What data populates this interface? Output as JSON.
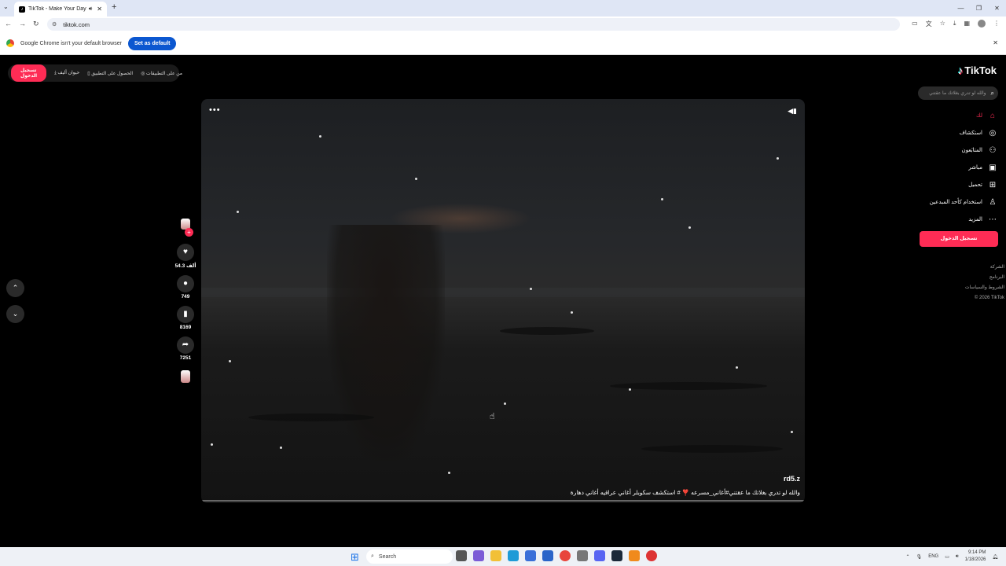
{
  "browser": {
    "tab_title": "TikTok - Make Your Day",
    "url": "tiktok.com",
    "infobar_text": "Google Chrome isn't your default browser",
    "set_default_label": "Set as default"
  },
  "top_pill": {
    "login_label": "تسجيل الدخول",
    "items": [
      "حيوان أليف",
      "الحصول على التطبيق",
      "من على التطبيقات"
    ]
  },
  "video": {
    "author": "rd5.z",
    "caption": "والله لو تدري بغلاتك ما عقتني#أغاني_مسرعه ❣️ # استكشف سكوبلر أغاني عراقيه أغاني دهارة"
  },
  "actions": {
    "likes": "54.3 ألف",
    "comments": "749",
    "bookmarks": "8169",
    "shares": "7251"
  },
  "sidebar": {
    "logo": "TikTok",
    "search_placeholder": "والله لو تدري بغلاتك ما عقتني",
    "items": [
      {
        "label": "لك",
        "icon": "home-icon"
      },
      {
        "label": "استكشاف",
        "icon": "compass-icon"
      },
      {
        "label": "المتابَعون",
        "icon": "following-icon"
      },
      {
        "label": "مباشر",
        "icon": "live-icon"
      },
      {
        "label": "تحميل",
        "icon": "upload-icon"
      },
      {
        "label": "استخدام كأحد المبدعين",
        "icon": "profile-icon"
      },
      {
        "label": "المزيد",
        "icon": "more-icon"
      }
    ],
    "login_label": "تسجيل الدخول",
    "footer": [
      "الشركة",
      "البرنامج",
      "الشروط والسياسات",
      "© 2026 TikTok"
    ]
  },
  "taskbar": {
    "search_label": "Search",
    "lang": "ENG",
    "time": "9:14 PM",
    "date": "1/18/2026"
  }
}
